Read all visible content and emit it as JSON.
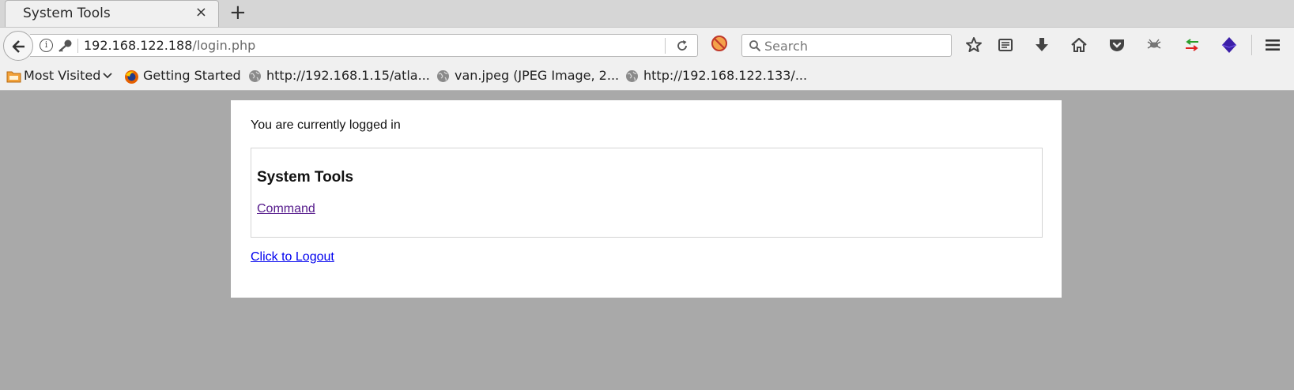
{
  "browser": {
    "tab_title": "System Tools",
    "tab_close": "×",
    "new_tab": "+",
    "url_host": "192.168.122.188",
    "url_path": "/login.php",
    "search_placeholder": "Search",
    "bookmarks": [
      {
        "label": "Most Visited",
        "icon": "folder-icon"
      },
      {
        "label": "Getting Started",
        "icon": "firefox-icon"
      },
      {
        "label": "http://192.168.1.15/atla...",
        "icon": "globe-icon"
      },
      {
        "label": "van.jpeg (JPEG Image, 2...",
        "icon": "globe-icon"
      },
      {
        "label": "http://192.168.122.133/...",
        "icon": "globe-icon"
      }
    ],
    "toolbar_icons": [
      "star-icon",
      "reading-list-icon",
      "download-icon",
      "home-icon",
      "pocket-icon",
      "spider-icon",
      "arrows-icon",
      "cube-icon",
      "hamburger-menu-icon"
    ]
  },
  "page": {
    "status_text": "You are currently logged in",
    "section_title": "System Tools",
    "command_link": "Command",
    "logout_link": "Click to Logout"
  },
  "colors": {
    "page_background": "#a9a9a9",
    "visited_link": "#551a8b",
    "link": "#0000ee"
  }
}
